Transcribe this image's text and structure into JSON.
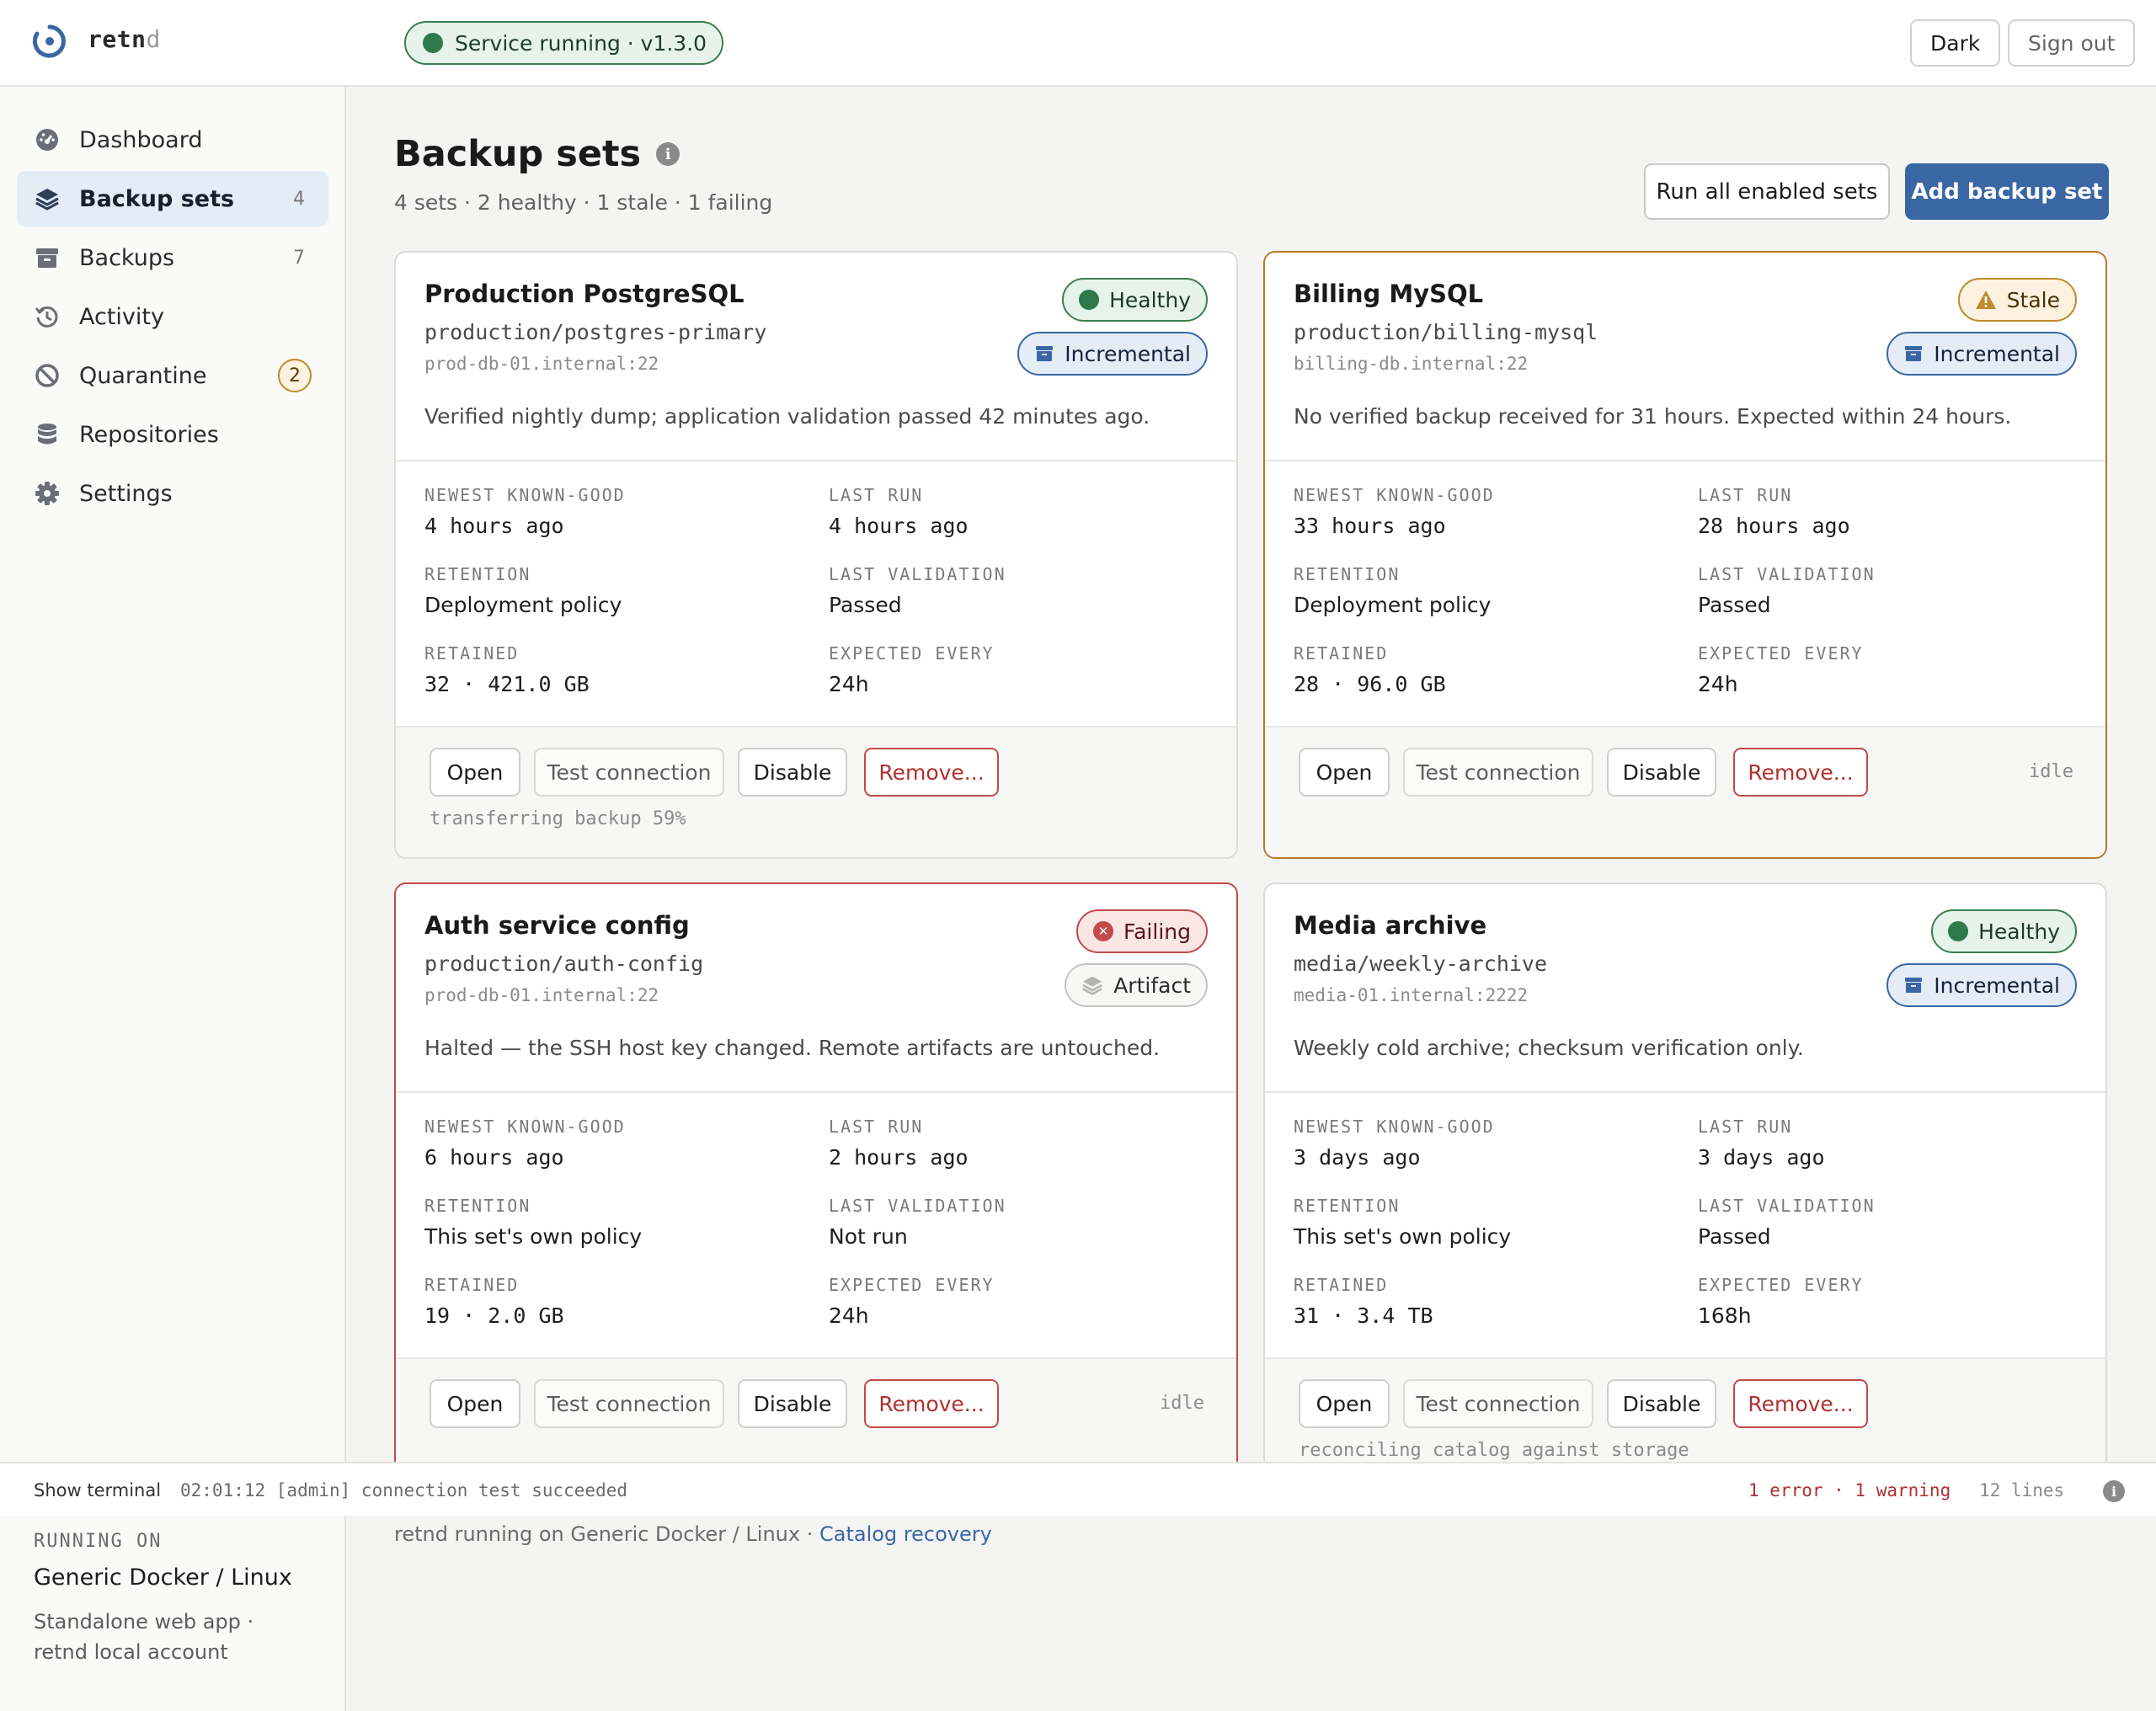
{
  "header": {
    "brand_main": "retn",
    "brand_dim": "d",
    "service_status": "Service running · v1.3.0",
    "theme_label": "Dark",
    "signout_label": "Sign out"
  },
  "sidebar": {
    "items": [
      {
        "label": "Dashboard",
        "icon": "dashboard-icon"
      },
      {
        "label": "Backup sets",
        "icon": "layers-icon",
        "count": "4",
        "active": true
      },
      {
        "label": "Backups",
        "icon": "archive-icon",
        "count": "7"
      },
      {
        "label": "Activity",
        "icon": "history-icon"
      },
      {
        "label": "Quarantine",
        "icon": "blocked-icon",
        "badge": "2"
      },
      {
        "label": "Repositories",
        "icon": "database-icon"
      },
      {
        "label": "Settings",
        "icon": "gear-icon"
      }
    ],
    "footer": {
      "label": "RUNNING ON",
      "title": "Generic Docker / Linux",
      "desc": "Standalone web app · retnd local account"
    }
  },
  "main": {
    "title": "Backup sets",
    "summary": "4 sets · 2 healthy · 1 stale · 1 failing",
    "run_all_label": "Run all enabled sets",
    "add_label": "Add backup set",
    "stat_labels": {
      "newest": "NEWEST KNOWN-GOOD",
      "last_run": "LAST RUN",
      "retention": "RETENTION",
      "last_validation": "LAST VALIDATION",
      "retained": "RETAINED",
      "expected": "EXPECTED EVERY"
    },
    "action_labels": {
      "open": "Open",
      "test": "Test connection",
      "disable": "Disable",
      "remove": "Remove..."
    },
    "cards": [
      {
        "name": "Production PostgreSQL",
        "path": "production/postgres-primary",
        "host": "prod-db-01.internal:22",
        "status": "Healthy",
        "kind": "Incremental",
        "desc": "Verified nightly dump; application validation passed 42 minutes ago.",
        "newest": "4 hours ago",
        "last_run": "4 hours ago",
        "retention": "Deployment policy",
        "last_validation": "Passed",
        "retained": "32 · 421.0 GB",
        "expected": "24h",
        "activity": "transferring backup 59%"
      },
      {
        "name": "Billing MySQL",
        "path": "production/billing-mysql",
        "host": "billing-db.internal:22",
        "status": "Stale",
        "kind": "Incremental",
        "desc": "No verified backup received for 31 hours. Expected within 24 hours.",
        "newest": "33 hours ago",
        "last_run": "28 hours ago",
        "retention": "Deployment policy",
        "last_validation": "Passed",
        "retained": "28 · 96.0 GB",
        "expected": "24h",
        "activity": "idle"
      },
      {
        "name": "Auth service config",
        "path": "production/auth-config",
        "host": "prod-db-01.internal:22",
        "status": "Failing",
        "kind": "Artifact",
        "desc": "Halted — the SSH host key changed. Remote artifacts are untouched.",
        "newest": "6 hours ago",
        "last_run": "2 hours ago",
        "retention": "This set's own policy",
        "last_validation": "Not run",
        "retained": "19 · 2.0 GB",
        "expected": "24h",
        "activity": "idle"
      },
      {
        "name": "Media archive",
        "path": "media/weekly-archive",
        "host": "media-01.internal:2222",
        "status": "Healthy",
        "kind": "Incremental",
        "desc": "Weekly cold archive; checksum verification only.",
        "newest": "3 days ago",
        "last_run": "3 days ago",
        "retention": "This set's own policy",
        "last_validation": "Passed",
        "retained": "31 · 3.4 TB",
        "expected": "168h",
        "activity": "reconciling catalog against storage"
      }
    ]
  },
  "terminal": {
    "toggle_label": "Show terminal",
    "last_line": "02:01:12 [admin] connection test succeeded",
    "counts": "1 error · 1 warning",
    "lines": "12 lines"
  },
  "footer": {
    "text": "retnd running on Generic Docker / Linux · ",
    "link": "Catalog recovery"
  },
  "colors": {
    "accent": "#3a67a4",
    "healthy": "#2f7a4a",
    "stale": "#c08a2a",
    "failing": "#c34a4a"
  }
}
